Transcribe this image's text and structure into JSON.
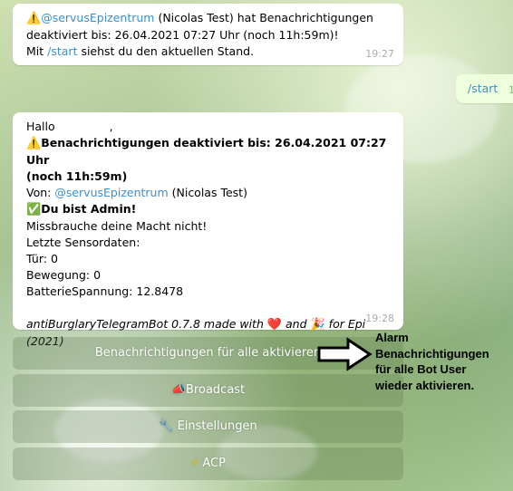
{
  "messages": {
    "msg1": {
      "warn_icon": "warning-icon",
      "mention": "@servusEpizentrum",
      "line1_rest": " (Nicolas Test) hat Benachrichtigungen",
      "line2": "deaktiviert bis: 26.04.2021 07:27 Uhr (noch 11h:59m)!",
      "line3_pre": "Mit ",
      "line3_cmd": "/start",
      "line3_post": " siehst du den aktuellen Stand.",
      "time": "19:27"
    },
    "outgoing": {
      "text": "/start",
      "time": "1"
    },
    "msg2": {
      "greeting": "Hallo",
      "comma": ",",
      "warn_icon": "warning-icon",
      "headline1": "Benachrichtigungen deaktiviert bis: 26.04.2021 07:27 Uhr",
      "headline2": "(noch 11h:59m)",
      "from_pre": "Von: ",
      "from_mention": "@servusEpizentrum",
      "from_post": " (Nicolas Test)",
      "admin_icon": "check-mark-icon",
      "admin": "Du bist Admin!",
      "misuse": "Missbrauche deine Macht nicht!",
      "sensor_header": "Letzte Sensordaten:",
      "door": "Tür: 0",
      "motion": "Bewegung: 0",
      "battery": "BatterieSpannung: 12.8478",
      "footer_pre": "antiBurglaryTelegramBot 0.7.8 made with ",
      "footer_and": " and ",
      "footer_post": " for Epi (2021)",
      "heart_icon": "heart-icon",
      "party_icon": "party-icon",
      "time": "19:28"
    }
  },
  "keyboard": {
    "enable_all": "Benachrichtigungen für alle aktivieren",
    "broadcast": "Broadcast",
    "broadcast_icon": "megaphone-icon",
    "settings": "Einstellungen",
    "settings_icon": "wrench-icon",
    "acp": "ACP",
    "acp_icon": "lightning-icon"
  },
  "annotation": {
    "line1": "Alarm",
    "line2": "Benachrichtigungen",
    "line3": "für alle Bot User",
    "line4": "wieder aktivieren."
  }
}
